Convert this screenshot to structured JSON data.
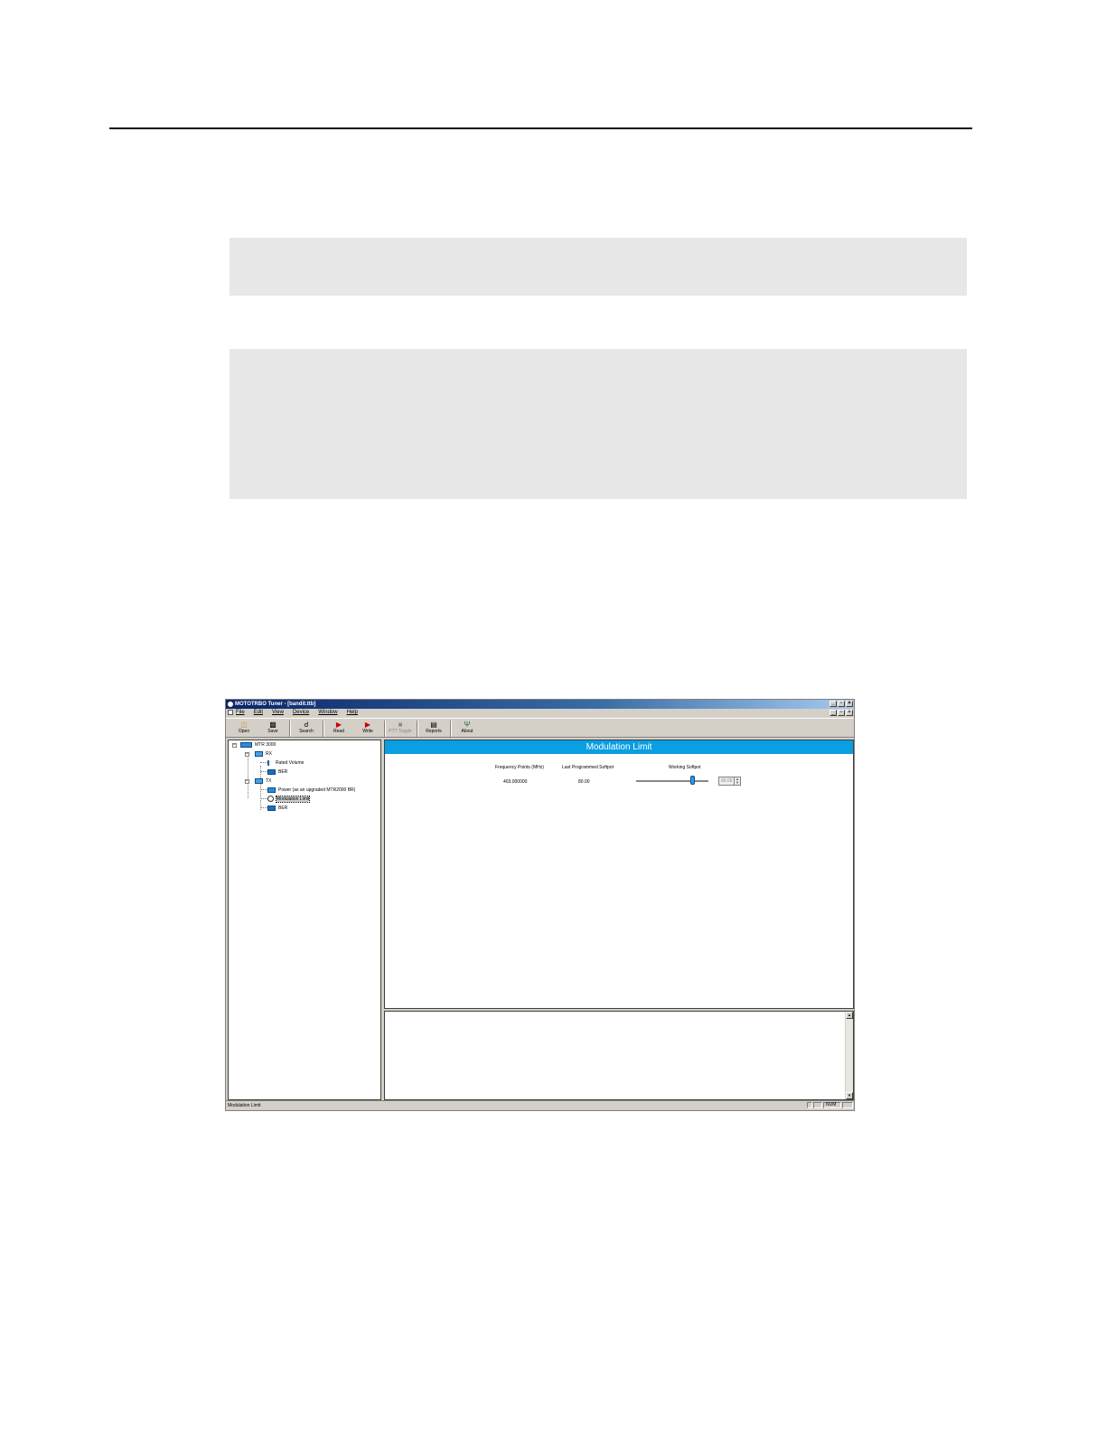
{
  "window": {
    "title": "MOTOTRBO Tuner - [bandit.ttb]",
    "min": "_",
    "restore": "▫",
    "close": "×"
  },
  "menu": [
    "File",
    "Edit",
    "View",
    "Device",
    "Window",
    "Help"
  ],
  "toolbar": {
    "open": "Open",
    "save": "Save",
    "search": "Search",
    "read": "Read",
    "write": "Write",
    "ptt": "PTT Toggle",
    "reports": "Reports",
    "about": "About"
  },
  "tree": {
    "root": "MTR 3000",
    "rx": "RX",
    "rated_volume": "Rated Volume",
    "rx_ber": "BER",
    "tx": "TX",
    "power": "Power (as an upgraded MTR2000 BR)",
    "modulation_limit": "Modulation Limit",
    "tx_ber": "BER"
  },
  "panel": {
    "title": "Modulation Limit",
    "col_frequency": "Frequency Points (MHz)",
    "col_last": "Last Programmed Softpot",
    "col_working": "Working Softpot",
    "frequency": "403.000000",
    "last_value": "80.00",
    "working_value": "80.00",
    "slider_level": 0.78
  },
  "scroll": {
    "up": "▲",
    "down": "▼"
  },
  "status": {
    "text": "Modulation Limit",
    "num": "NUM"
  },
  "colors": {
    "panel_header": "#0a9ee2",
    "title_gradient_start": "#0a246a",
    "gray_box": "#e7e7e7"
  }
}
